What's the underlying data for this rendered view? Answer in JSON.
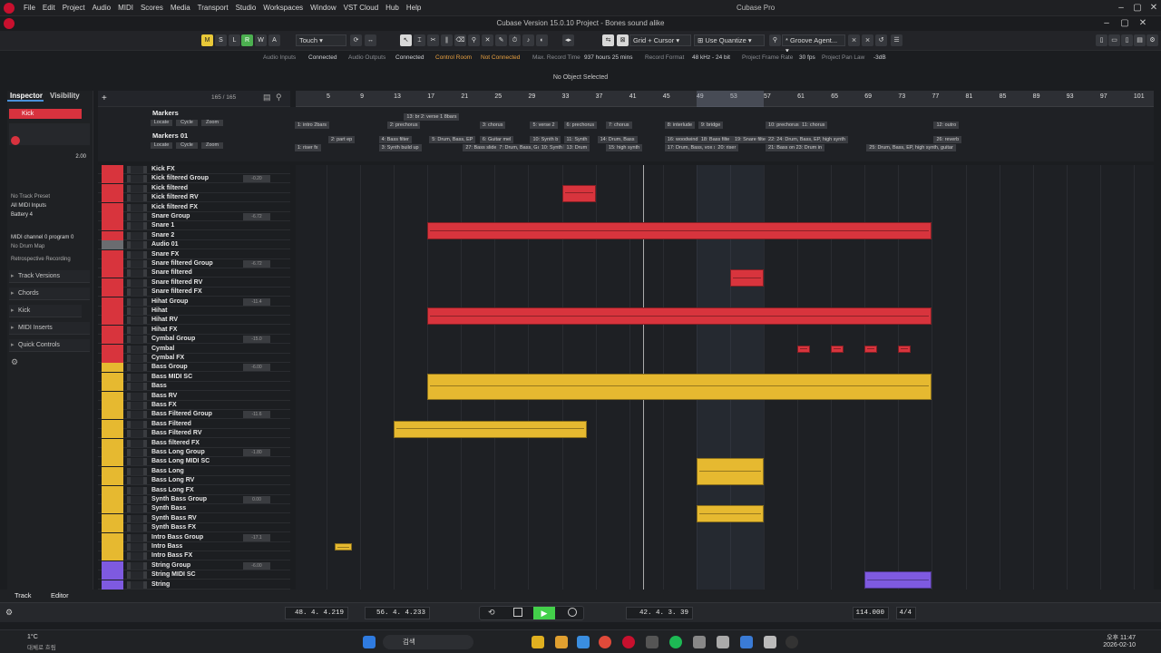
{
  "menubar": {
    "items": [
      "File",
      "Edit",
      "Project",
      "Audio",
      "MIDI",
      "Scores",
      "Media",
      "Transport",
      "Studio",
      "Workspaces",
      "Window",
      "VST Cloud",
      "Hub",
      "Help"
    ],
    "title": "Cubase Pro"
  },
  "window": {
    "title": "Cubase Version 15.0.10 Project - Bones sound alike"
  },
  "toolbar": {
    "m": "M",
    "s": "S",
    "l": "L",
    "r": "R",
    "w": "W",
    "a": "A",
    "automation_mode": "Touch",
    "snap_type": "Grid + Cursor",
    "quantize": "Use Quantize",
    "groove": "* Groove Agent..."
  },
  "status": {
    "audio_inputs_label": "Audio Inputs",
    "audio_inputs": "Connected",
    "audio_outputs_label": "Audio Outputs",
    "audio_outputs": "Connected",
    "control_room_label": "Control Room",
    "control_room": "Not Connected",
    "max_record_label": "Max. Record Time",
    "max_record": "937 hours 25 mins",
    "record_format_label": "Record Format",
    "record_format": "48 kHz - 24 bit",
    "frame_rate_label": "Project Frame Rate",
    "frame_rate": "30 fps",
    "pan_law_label": "Project Pan Law",
    "pan_law": "-3dB"
  },
  "info_line": "No Object Selected",
  "inspector": {
    "tab_inspector": "Inspector",
    "tab_visibility": "Visibility",
    "track_name": "Kick",
    "volume": "2.00",
    "no_track_preset": "No Track Preset",
    "midi_inputs": "All MIDI Inputs",
    "instrument": "Battery 4",
    "midi_channel": "MIDI channel 0 program 0",
    "drum_map": "No Drum Map",
    "retro": "Retrospective Recording",
    "sections": [
      "Track Versions",
      "Chords"
    ],
    "kick2": "Kick",
    "sections2": [
      "MIDI Inserts",
      "Quick Controls"
    ]
  },
  "track_header": {
    "count": "165 / 165"
  },
  "ruler": {
    "bars": [
      "5",
      "9",
      "13",
      "17",
      "21",
      "25",
      "29",
      "33",
      "37",
      "41",
      "45",
      "49",
      "53",
      "57",
      "61",
      "65",
      "69",
      "73",
      "77",
      "81",
      "85",
      "89",
      "93",
      "97",
      "101"
    ]
  },
  "markers": {
    "track1": "Markers",
    "track2": "Markers 01",
    "locate": "Locate",
    "cycle": "Cycle",
    "zoom": "Zoom",
    "row1": [
      "1: intro 2bars",
      "2: prechorus",
      "3: chorus",
      "5: verse 2",
      "6: prechorus",
      "7: chorus",
      "8: interlude",
      "9: bridge",
      "10: prechorus",
      "11: chorus",
      "12: outro"
    ],
    "row1b": [
      "13: br 2: verse 1 8bars"
    ],
    "row2": [
      "2: part ep",
      "4: Bass filter",
      "5: Drum, Bass, EP",
      "6: Guitar mel",
      "10: Synth b",
      "11: Synth",
      "14: Drum, Bass",
      "16: woodwind",
      "18: Bass filte",
      "19: Snare filtered",
      "22: 24: Drum, Bass, EP, high synth",
      "26: reverb"
    ],
    "row3": [
      "1: riser fx",
      "3: Synth build up",
      "27: Bass slide",
      "7: Drum, Bass, Guitar(wah)",
      "10: Synth b",
      "13: Drum",
      "15: high synth",
      "17: Drum, Bass, vox synth",
      "20: riser",
      "21: Bass on 23: Drum in",
      "25: Drum, Bass, EP, high synth, guitar"
    ]
  },
  "tracks": [
    {
      "name": "Kick FX",
      "color": "#d8343d"
    },
    {
      "name": "Kick filtered Group",
      "color": "#d8343d",
      "vol": "-0.20"
    },
    {
      "name": "Kick filtered",
      "color": "#d8343d"
    },
    {
      "name": "Kick filtered RV",
      "color": "#d8343d"
    },
    {
      "name": "Kick filtered FX",
      "color": "#d8343d"
    },
    {
      "name": "Snare Group",
      "color": "#d8343d",
      "vol": "-6.72"
    },
    {
      "name": "Snare 1",
      "color": "#d8343d"
    },
    {
      "name": "Snare 2",
      "color": "#d8343d"
    },
    {
      "name": "Audio 01",
      "color": "#6a6c70"
    },
    {
      "name": "Snare FX",
      "color": "#d8343d"
    },
    {
      "name": "Snare filtered Group",
      "color": "#d8343d",
      "vol": "-6.72"
    },
    {
      "name": "Snare filtered",
      "color": "#d8343d"
    },
    {
      "name": "Snare filtered RV",
      "color": "#d8343d"
    },
    {
      "name": "Snare filtered FX",
      "color": "#d8343d"
    },
    {
      "name": "Hihat Group",
      "color": "#d8343d",
      "vol": "-11.4"
    },
    {
      "name": "Hihat",
      "color": "#d8343d"
    },
    {
      "name": "Hihat RV",
      "color": "#d8343d"
    },
    {
      "name": "Hihat FX",
      "color": "#d8343d"
    },
    {
      "name": "Cymbal Group",
      "color": "#d8343d",
      "vol": "-15.0"
    },
    {
      "name": "Cymbal",
      "color": "#d8343d"
    },
    {
      "name": "Cymbal FX",
      "color": "#d8343d"
    },
    {
      "name": "Bass Group",
      "color": "#e6b930",
      "vol": "-6.00"
    },
    {
      "name": "Bass MIDI SC",
      "color": "#e6b930"
    },
    {
      "name": "Bass",
      "color": "#e6b930"
    },
    {
      "name": "Bass RV",
      "color": "#e6b930"
    },
    {
      "name": "Bass FX",
      "color": "#e6b930"
    },
    {
      "name": "Bass Filtered Group",
      "color": "#e6b930",
      "vol": "-11.6"
    },
    {
      "name": "Bass Filtered",
      "color": "#e6b930"
    },
    {
      "name": "Bass Filtered RV",
      "color": "#e6b930"
    },
    {
      "name": "Bass filtered FX",
      "color": "#e6b930"
    },
    {
      "name": "Bass Long Group",
      "color": "#e6b930",
      "vol": "-1.80"
    },
    {
      "name": "Bass Long MIDI SC",
      "color": "#e6b930"
    },
    {
      "name": "Bass Long",
      "color": "#e6b930"
    },
    {
      "name": "Bass Long RV",
      "color": "#e6b930"
    },
    {
      "name": "Bass Long FX",
      "color": "#e6b930"
    },
    {
      "name": "Synth Bass Group",
      "color": "#e6b930",
      "vol": "0.00"
    },
    {
      "name": "Synth Bass",
      "color": "#e6b930"
    },
    {
      "name": "Synth Bass RV",
      "color": "#e6b930"
    },
    {
      "name": "Synth Bass FX",
      "color": "#e6b930"
    },
    {
      "name": "Intro Bass Group",
      "color": "#e6b930",
      "vol": "-17.1"
    },
    {
      "name": "Intro Bass",
      "color": "#e6b930"
    },
    {
      "name": "Intro Bass FX",
      "color": "#e6b930"
    },
    {
      "name": "String Group",
      "color": "#7e5ae0",
      "vol": "-6.00"
    },
    {
      "name": "String MIDI SC",
      "color": "#7e5ae0"
    },
    {
      "name": "String",
      "color": "#7e5ae0"
    },
    {
      "name": "String RV",
      "color": "#7e5ae0"
    }
  ],
  "events": [
    {
      "track": 2,
      "start": 33,
      "end": 37,
      "color": "red",
      "rows": 2
    },
    {
      "track": 6,
      "start": 17,
      "end": 77,
      "color": "red",
      "rows": 2
    },
    {
      "track": 11,
      "start": 53,
      "end": 57,
      "color": "red",
      "rows": 2
    },
    {
      "track": 15,
      "start": 17,
      "end": 77,
      "color": "red",
      "rows": 2
    },
    {
      "track": 19,
      "start": 61,
      "end": 62.5,
      "color": "red",
      "rows": 1
    },
    {
      "track": 19,
      "start": 65,
      "end": 66.5,
      "color": "red",
      "rows": 1
    },
    {
      "track": 19,
      "start": 69,
      "end": 70.5,
      "color": "red",
      "rows": 1
    },
    {
      "track": 19,
      "start": 73,
      "end": 74.5,
      "color": "red",
      "rows": 1
    },
    {
      "track": 22,
      "start": 17,
      "end": 77,
      "color": "yel",
      "rows": 3
    },
    {
      "track": 27,
      "start": 13,
      "end": 36,
      "color": "yel",
      "rows": 2
    },
    {
      "track": 31,
      "start": 49,
      "end": 57,
      "color": "yel",
      "rows": 3
    },
    {
      "track": 36,
      "start": 49,
      "end": 57,
      "color": "yel",
      "rows": 2
    },
    {
      "track": 40,
      "start": 6,
      "end": 8,
      "color": "yel",
      "rows": 1
    },
    {
      "track": 43,
      "start": 69,
      "end": 77,
      "color": "pur",
      "rows": 2
    }
  ],
  "bottom": {
    "track_tab": "Track",
    "editor_tab": "Editor"
  },
  "transport": {
    "left_locator": "48. 4. 4.219",
    "right_locator": "56. 4. 4.233",
    "position": "42. 4. 3. 39",
    "tempo": "114.000",
    "signature": "4/4"
  },
  "taskbar": {
    "weather_temp": "1°C",
    "weather_desc": "대체로 흐림",
    "search": "검색",
    "time": "오후 11:47",
    "date": "2026-02-10"
  }
}
